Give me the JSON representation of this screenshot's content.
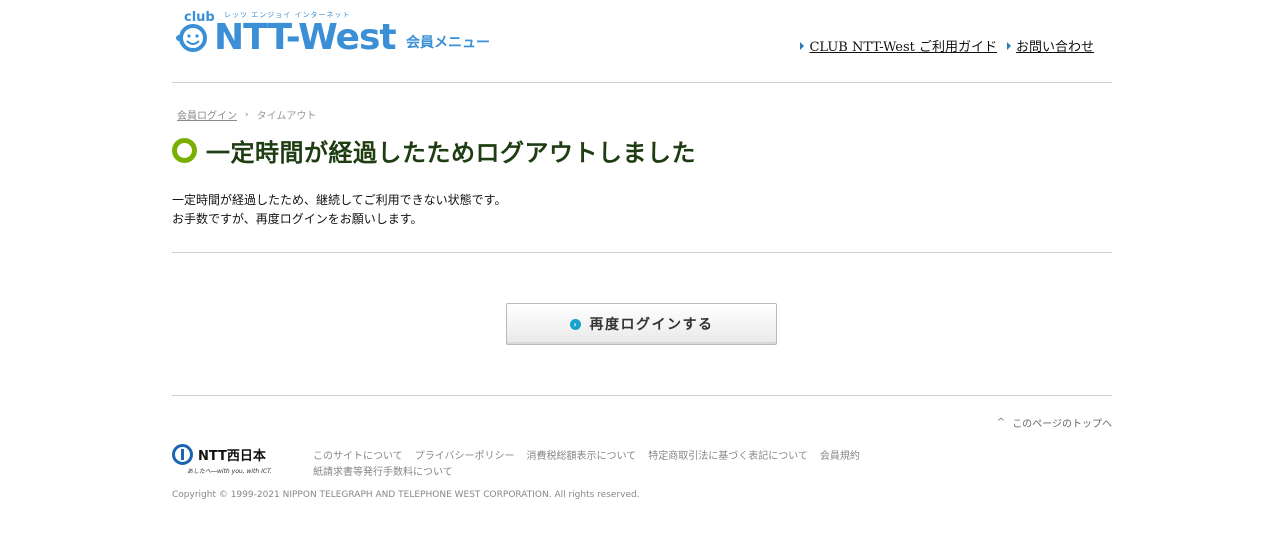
{
  "header": {
    "logo_club": "club",
    "logo_kana": "レッツ エンジョイ インターネット",
    "logo_mark": "NTT-West",
    "logo_menu": "会員メニュー",
    "links": [
      "CLUB NTT-West ご利用ガイド",
      "お問い合わせ"
    ]
  },
  "breadcrumb": {
    "home": "会員ログイン",
    "current": "タイムアウト"
  },
  "main": {
    "title": "一定時間が経過したためログアウトしました",
    "message_line1": "一定時間が経過したため、継続してご利用できない状態です。",
    "message_line2": "お手数ですが、再度ログインをお願いします。",
    "button_label": "再度ログインする"
  },
  "footer": {
    "to_top": "このページのトップへ",
    "brand": "NTT西日本",
    "tagline": "あしたへ―with you, with ICT.",
    "links": [
      "このサイトについて",
      "プライバシーポリシー",
      "消費税総額表示について",
      "特定商取引法に基づく表記について",
      "会員規約",
      "紙請求書等発行手数料について"
    ],
    "copyright": "Copyright © 1999-2021 NIPPON TELEGRAPH AND TELEPHONE WEST CORPORATION. All rights reserved."
  },
  "colors": {
    "brand_blue": "#3a8fd6",
    "title_green": "#79b000",
    "button_dot": "#19a2c9"
  }
}
